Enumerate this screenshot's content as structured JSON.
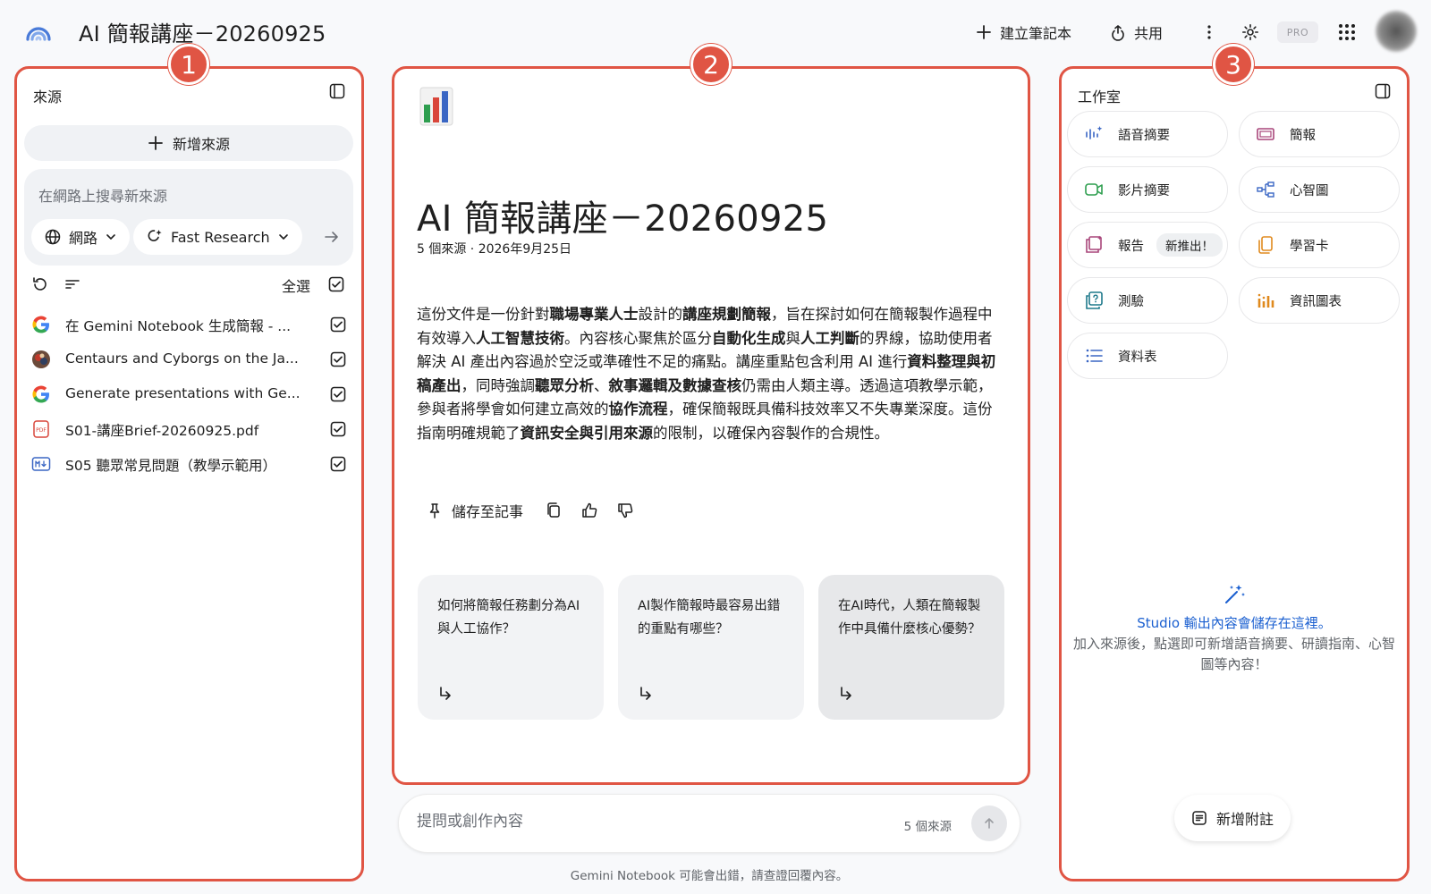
{
  "header": {
    "title": "AI 簡報講座－20260925",
    "create_notebook": "建立筆記本",
    "share": "共用",
    "pro_badge": "PRO"
  },
  "badges": [
    "1",
    "2",
    "3"
  ],
  "sources": {
    "title": "來源",
    "add_source": "新增來源",
    "search_placeholder": "在網路上搜尋新來源",
    "chip_web": "網路",
    "chip_research": "Fast Research",
    "select_all": "全選",
    "items": [
      {
        "label": "在 Gemini Notebook 生成簡報 - ...",
        "icon": "google-icon",
        "checked": true
      },
      {
        "label": "Centaurs and Cyborgs on the Ja...",
        "icon": "thumbnail-icon",
        "checked": true
      },
      {
        "label": "Generate presentations with Ge...",
        "icon": "google-icon",
        "checked": true
      },
      {
        "label": "S01-講座Brief-20260925.pdf",
        "icon": "pdf-icon",
        "checked": true
      },
      {
        "label": "S05 聽眾常見問題（教學示範用）",
        "icon": "markdown-icon",
        "checked": true
      }
    ]
  },
  "chat": {
    "doc_title": "AI 簡報講座－20260925",
    "meta": "5 個來源 · 2026年9月25日",
    "summary": [
      {
        "t": "這份文件是一份針對",
        "b": false
      },
      {
        "t": "職場專業人士",
        "b": true
      },
      {
        "t": "設計的",
        "b": false
      },
      {
        "t": "講座規劃簡報",
        "b": true
      },
      {
        "t": "，旨在探討如何在簡報製作過程中有效導入",
        "b": false
      },
      {
        "t": "人工智慧技術",
        "b": true
      },
      {
        "t": "。內容核心聚焦於區分",
        "b": false
      },
      {
        "t": "自動化生成",
        "b": true
      },
      {
        "t": "與",
        "b": false
      },
      {
        "t": "人工判斷",
        "b": true
      },
      {
        "t": "的界線，協助使用者解決 AI 產出內容過於空泛或準確性不足的痛點。講座重點包含利用 AI 進行",
        "b": false
      },
      {
        "t": "資料整理與初稿產出",
        "b": true
      },
      {
        "t": "，同時強調",
        "b": false
      },
      {
        "t": "聽眾分析",
        "b": true
      },
      {
        "t": "、",
        "b": false
      },
      {
        "t": "敘事邏輯及數據查核",
        "b": true
      },
      {
        "t": "仍需由人類主導。透過這項教學示範，參與者將學會如何建立高效的",
        "b": false
      },
      {
        "t": "協作流程",
        "b": true
      },
      {
        "t": "，確保簡報既具備科技效率又不失專業深度。這份指南明確規範了",
        "b": false
      },
      {
        "t": "資訊安全與引用來源",
        "b": true
      },
      {
        "t": "的限制，以確保內容製作的合規性。",
        "b": false
      }
    ],
    "save_note": "儲存至記事",
    "suggestions": [
      "如何將簡報任務劃分為AI與人工協作？",
      "AI製作簡報時最容易出錯的重點有哪些？",
      "在AI時代，人類在簡報製作中具備什麼核心優勢？"
    ],
    "query_placeholder": "提問或創作內容",
    "query_count": "5 個來源",
    "disclaimer": "Gemini Notebook 可能會出錯，請查證回覆內容。"
  },
  "studio": {
    "title": "工作室",
    "tiles": [
      {
        "label": "語音摘要",
        "icon": "audio-overview-icon"
      },
      {
        "label": "簡報",
        "icon": "slides-icon"
      },
      {
        "label": "影片摘要",
        "icon": "video-overview-icon"
      },
      {
        "label": "心智圖",
        "icon": "mind-map-icon"
      },
      {
        "label": "報告",
        "icon": "report-icon",
        "badge": "新推出！"
      },
      {
        "label": "學習卡",
        "icon": "flashcards-icon"
      },
      {
        "label": "測驗",
        "icon": "quiz-icon"
      },
      {
        "label": "資訊圖表",
        "icon": "infographic-icon"
      },
      {
        "label": "資料表",
        "icon": "data-table-icon"
      }
    ],
    "empty_line1": "Studio 輸出內容會儲存在這裡。",
    "empty_line2": "加入來源後，點選即可新增語音摘要、研讀指南、心智圖等內容！",
    "add_note": "新增附註"
  },
  "colors": {
    "annotation": "#e05544",
    "studio_link": "#1a5fd0"
  }
}
